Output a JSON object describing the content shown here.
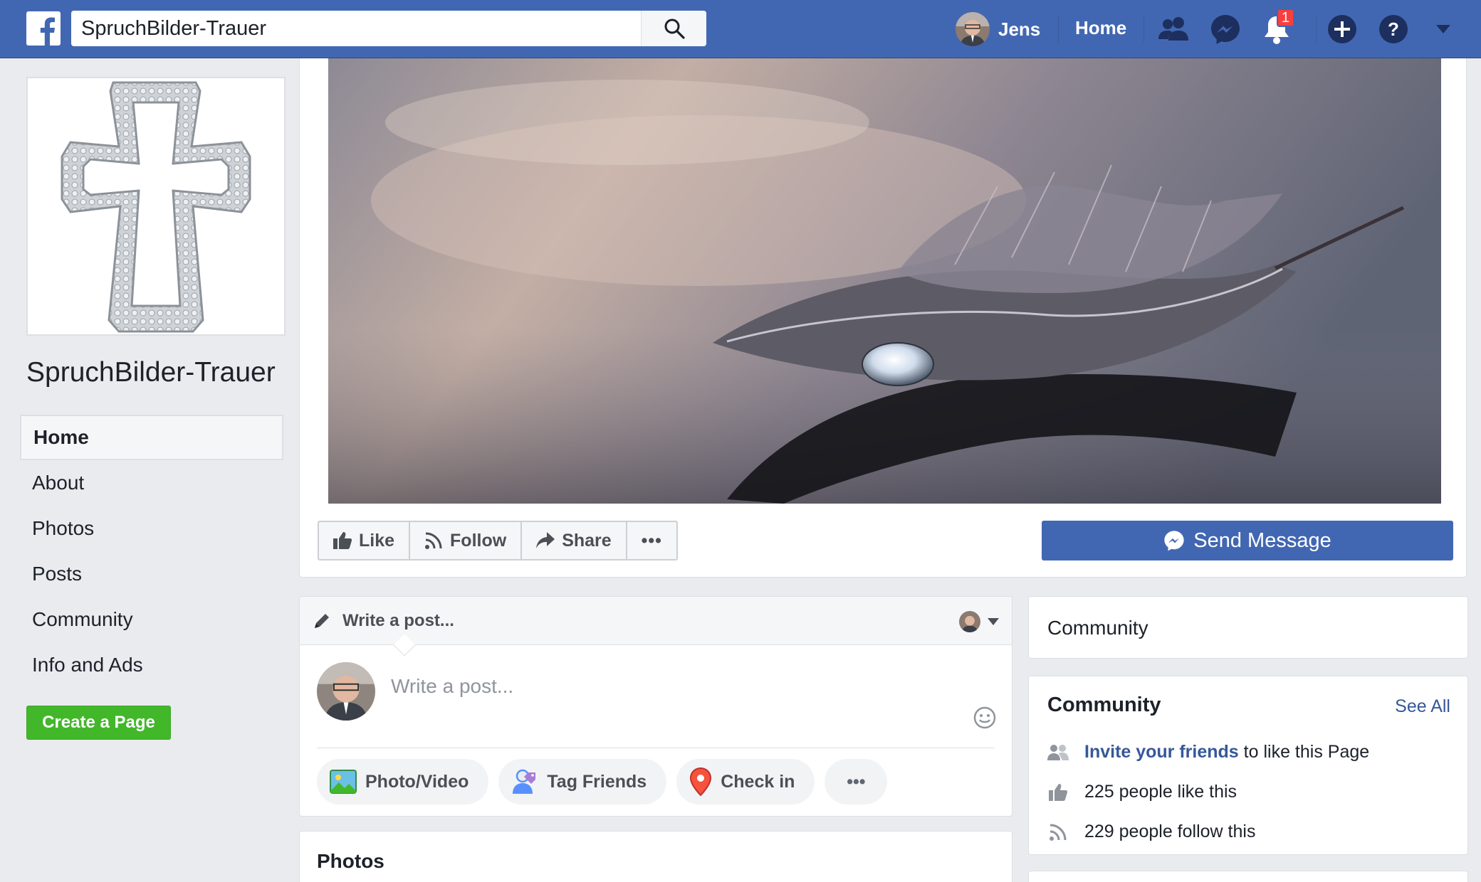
{
  "topbar": {
    "search_value": "SpruchBilder-Trauer",
    "user_name": "Jens",
    "home_label": "Home",
    "notification_count": "1",
    "brand_color": "#4267b2",
    "icons": [
      "facebook-logo-icon",
      "search-icon",
      "friends-icon",
      "messenger-icon",
      "notifications-icon",
      "create-icon",
      "help-icon",
      "account-menu-icon"
    ]
  },
  "page": {
    "name": "SpruchBilder-Trauer"
  },
  "sidebar": {
    "items": [
      {
        "label": "Home"
      },
      {
        "label": "About"
      },
      {
        "label": "Photos"
      },
      {
        "label": "Posts"
      },
      {
        "label": "Community"
      },
      {
        "label": "Info and Ads"
      }
    ],
    "active": "Home",
    "create_page_label": "Create a Page"
  },
  "actions": {
    "like_label": "Like",
    "follow_label": "Follow",
    "share_label": "Share",
    "more_label": "•••",
    "send_message_label": "Send Message"
  },
  "composer": {
    "header_label": "Write a post...",
    "placeholder": "Write a post...",
    "pills": [
      {
        "label": "Photo/Video",
        "icon": "photo-icon"
      },
      {
        "label": "Tag Friends",
        "icon": "tag-friends-icon"
      },
      {
        "label": "Check in",
        "icon": "location-pin-icon"
      },
      {
        "label": "•••",
        "icon": "more-icon"
      }
    ]
  },
  "photos_section": {
    "title": "Photos"
  },
  "community_tab": {
    "title": "Community"
  },
  "community_card": {
    "title": "Community",
    "see_all": "See All",
    "invite_link": "Invite your friends",
    "invite_rest": "to like this Page",
    "likes_text": "225 people like this",
    "follows_text": "229 people follow this"
  }
}
